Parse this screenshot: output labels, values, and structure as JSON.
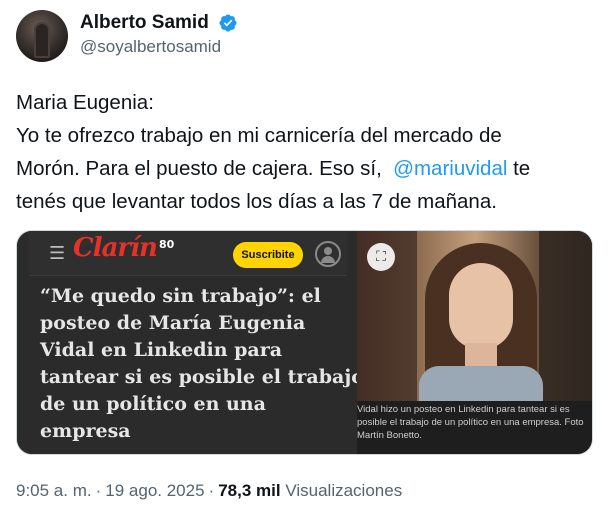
{
  "author": {
    "display_name": "Alberto Samid",
    "handle": "@soyalbertosamid",
    "verified": true,
    "verified_color": "#1d9bf0"
  },
  "tweet": {
    "line1": "Maria Eugenia:",
    "line2": "Yo te ofrezco trabajo en mi carnicería del mercado de",
    "line3_pre": "Morón. Para el puesto de cajera. Eso sí,  ",
    "mention": "@mariuvidal",
    "line3_post": " te",
    "line4": "tenés que levantar todos los días a las 7 de mañana."
  },
  "card": {
    "site_logo": "Clarín",
    "logo_badge": "80",
    "subscribe_label": "Suscribite",
    "headline_lines": [
      "“Me quedo sin trabajo”: el",
      "posteo de María Eugenia",
      "Vidal en Linkedin para",
      "tantear si es posible el trabajo",
      "de un político en una",
      "empresa"
    ],
    "caption_lines": [
      "Vidal hizo un posteo en Linkedin para tantear si es",
      "posible el trabajo de un político en una empresa. Foto",
      "Martín Bonetto."
    ],
    "icons": {
      "menu": "hamburger-icon",
      "user": "user-icon",
      "expand": "expand-icon"
    }
  },
  "meta": {
    "time": "9:05 a. m.",
    "separator1": "·",
    "date": "19 ago. 2025",
    "separator2": "·",
    "views_count": "78,3 mil",
    "views_label": "Visualizaciones"
  }
}
